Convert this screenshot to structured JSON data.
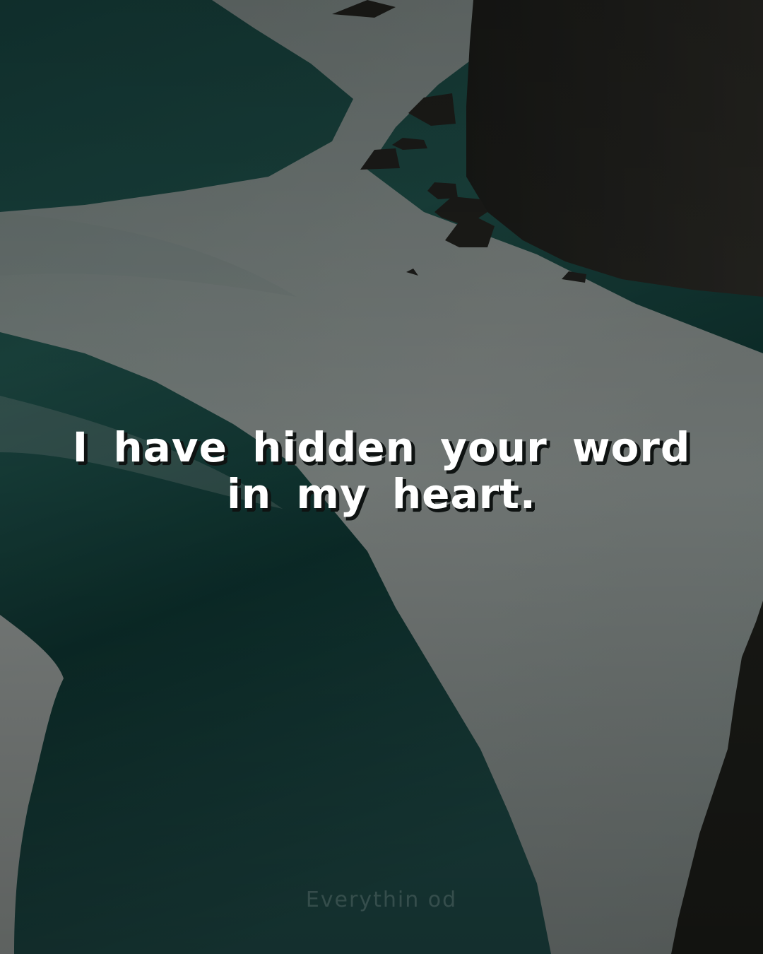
{
  "quote": {
    "line1": "I have hidden your word",
    "line2": "in my heart."
  },
  "watermark": {
    "text": "Everythin od"
  },
  "colors": {
    "sea_dark": "#123b38",
    "sea_teal": "#2a6a62",
    "foam": "#c9ccc9",
    "cliff": "#2a2b28",
    "overlay": "#000000",
    "text": "#ffffff",
    "text_shadow": "#0f1312"
  }
}
